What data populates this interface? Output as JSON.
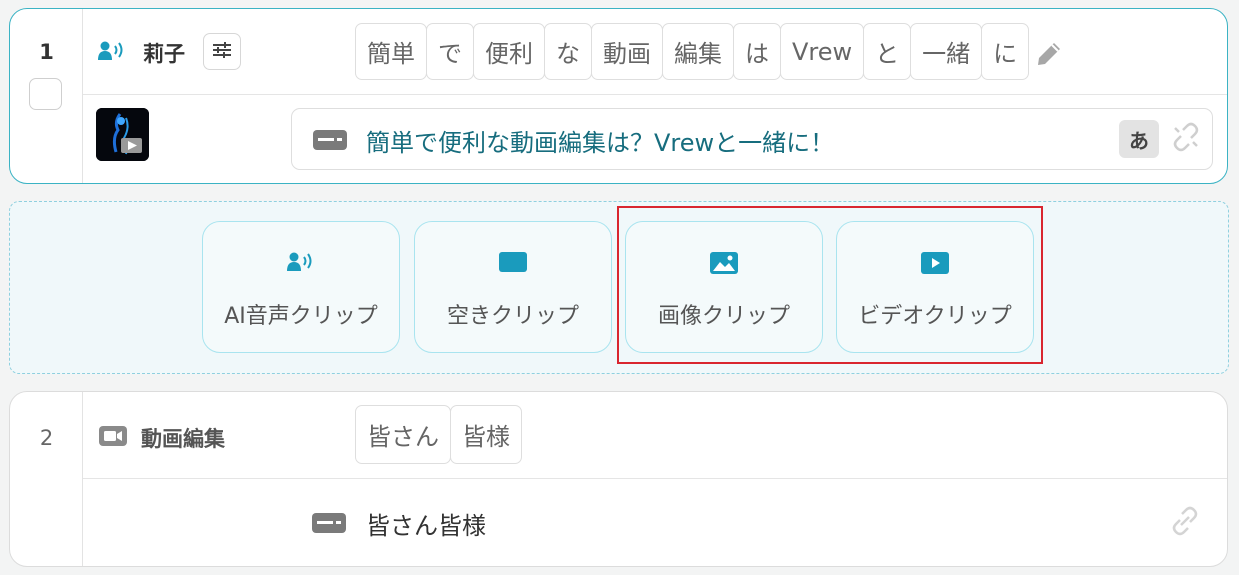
{
  "clips": [
    {
      "number": "1",
      "speaker": "莉子",
      "words": [
        "簡単",
        "で",
        "便利",
        "な",
        "動画",
        "編集",
        "は",
        "Vrew",
        "と",
        "一緒",
        "に"
      ],
      "subtitle": "簡単で便利な動画編集は？Vrewと一緒に！",
      "lang_badge": "あ"
    },
    {
      "number": "2",
      "title": "動画編集",
      "words": [
        "皆さん",
        "皆様"
      ],
      "subtitle": "皆さん皆様"
    }
  ],
  "insert_buttons": [
    {
      "label": "AI音声クリップ",
      "icon": "ai-voice-icon"
    },
    {
      "label": "空きクリップ",
      "icon": "empty-clip-icon"
    },
    {
      "label": "画像クリップ",
      "icon": "image-icon"
    },
    {
      "label": "ビデオクリップ",
      "icon": "video-play-icon"
    }
  ],
  "colors": {
    "accent": "#1a9bbd",
    "clip_border_active": "#3bb3c4",
    "subtitle_text": "#176d7e",
    "highlight": "#d9262f",
    "panel_bg": "#f0f8fa"
  }
}
